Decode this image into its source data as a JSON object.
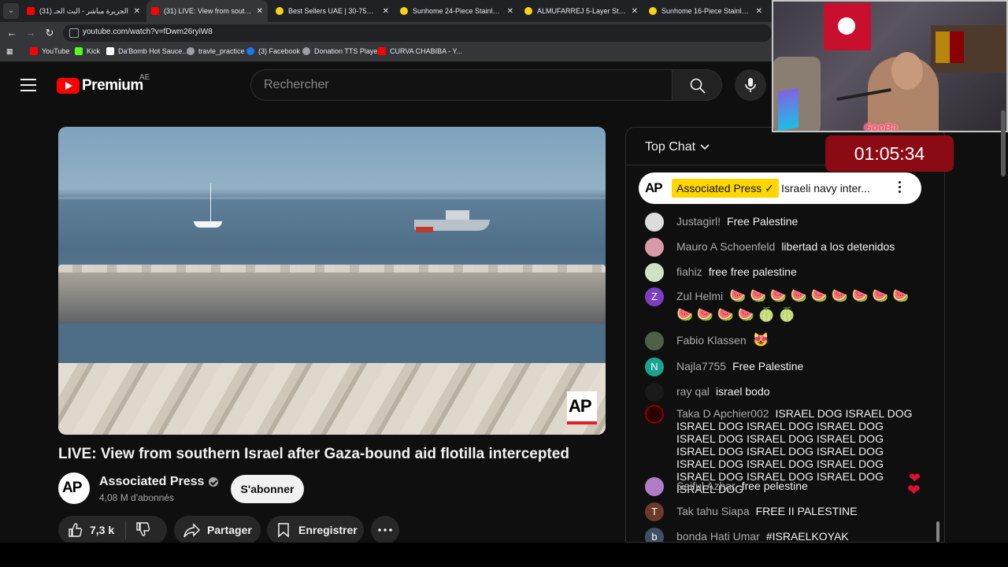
{
  "browser": {
    "tabs": [
      {
        "title": "(31) الجزيرة مباشر - البث الحـ",
        "favicon": "youtube",
        "active": false
      },
      {
        "title": "(31) LIVE: View from southern Is",
        "favicon": "youtube",
        "active": true
      },
      {
        "title": "Best Sellers UAE | 30-75% OFF |",
        "favicon": "yellow-smile",
        "active": false
      },
      {
        "title": "Sunhome 24-Piece Stainless St",
        "favicon": "yellow-smile",
        "active": false
      },
      {
        "title": "ALMUFARREJ 5-Layer Stylish Sh",
        "favicon": "yellow-smile",
        "active": false
      },
      {
        "title": "Sunhome 16-Piece Stainless St",
        "favicon": "yellow-smile",
        "active": false
      }
    ],
    "url": "youtube.com/watch?v=fDwm26ryiW8",
    "bookmarks": [
      {
        "label": "YouTube",
        "icon": "youtube-icon"
      },
      {
        "label": "Kick",
        "icon": "kick-icon"
      },
      {
        "label": "Da'Bomb Hot Sauce...",
        "icon": "link-icon"
      },
      {
        "label": "travle_practice",
        "icon": "compass-icon"
      },
      {
        "label": "(3) Facebook",
        "icon": "facebook-icon"
      },
      {
        "label": "Donation TTS Player",
        "icon": "globe-icon"
      },
      {
        "label": "CURVA CHABIBA - Y...",
        "icon": "youtube-icon"
      }
    ]
  },
  "header": {
    "logo_text": "Premium",
    "country_code": "AE",
    "search_placeholder": "Rechercher"
  },
  "video": {
    "title": "LIVE: View from southern Israel after Gaza-bound aid flotilla intercepted",
    "watermark": "AP",
    "channel": {
      "name": "Associated Press",
      "avatar_text": "AP",
      "subscribers": "4,08 M d'abonnés",
      "subscribe_label": "S'abonner"
    },
    "actions": {
      "likes": "7,3 k",
      "share_label": "Partager",
      "save_label": "Enregistrer"
    }
  },
  "chat": {
    "header_title": "Top Chat",
    "pinned": {
      "logo": "AP",
      "author": "Associated Press ✓",
      "message": "Israeli navy inter..."
    },
    "messages": [
      {
        "author": "Justagirl!",
        "text": "Free Palestine",
        "avatar": "",
        "avatar_color": "#dcdcdc"
      },
      {
        "author": "Mauro A Schoenfeld",
        "text": "libertad a los detenidos",
        "avatar": "",
        "avatar_color": "#d89aa6"
      },
      {
        "author": "fiahiz",
        "text": "free free palestine",
        "avatar": "",
        "avatar_color": "#cfe3c4"
      },
      {
        "author": "Zul Helmi",
        "text": "🍉 🍉 🍉 🍉 🍉 🍉 🍉 🍉 🍉 🍉 🍉 🍉 🍉 🍈 🍈",
        "avatar": "Z",
        "avatar_color": "#7b3fbf"
      },
      {
        "author": "Fabio Klassen",
        "text": "😻",
        "avatar": "",
        "avatar_color": "#4f6046"
      },
      {
        "author": "Najla7755",
        "text": "Free Palestine",
        "avatar": "N",
        "avatar_color": "#1aa291"
      },
      {
        "author": "ray qal",
        "text": "israel bodo",
        "avatar": "",
        "avatar_color": "#1a1a1a"
      },
      {
        "author": "Taka D Apchier002",
        "text": "ISRAEL DOG ISRAEL DOG ISRAEL DOG ISRAEL DOG ISRAEL DOG ISRAEL DOG ISRAEL DOG ISRAEL DOG ISRAEL DOG ISRAEL DOG ISRAEL DOG ISRAEL DOG ISRAEL DOG ISRAEL DOG ISRAEL DOG ISRAEL DOG ISRAEL DOG ISRAEL DOG",
        "avatar": "",
        "avatar_color": "#2a0000"
      },
      {
        "author": "Saiful Azhar",
        "text": "free pelestine",
        "avatar": "",
        "avatar_color": "#b07cc6"
      },
      {
        "author": "Tak tahu Siapa",
        "text": "FREE II PALESTINE",
        "avatar": "T",
        "avatar_color": "#6b3a2a"
      },
      {
        "author": "bonda Hati Umar",
        "text": "#ISRAELKOYAK",
        "avatar": "b",
        "avatar_color": "#3d4f63"
      }
    ]
  },
  "overlay": {
    "streamer_name": "GooBa",
    "timer": "01:05:34"
  },
  "colors": {
    "youtube_red": "#ff0000",
    "pinned_badge": "#ffd600",
    "timer_bg": "#8b0a14"
  }
}
